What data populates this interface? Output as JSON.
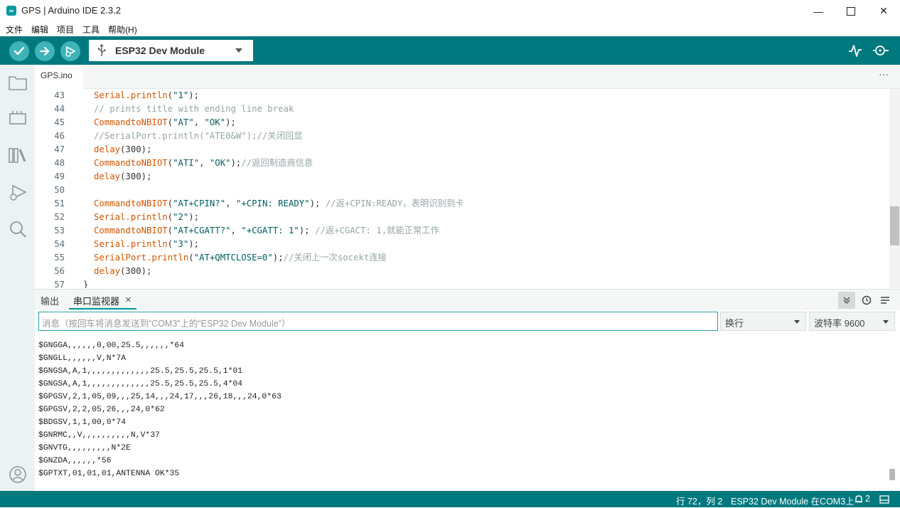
{
  "window": {
    "title": "GPS | Arduino IDE 2.3.2",
    "minimize_glyph": "—",
    "maximize_glyph": "☐",
    "close_glyph": "✕"
  },
  "menu": [
    "文件",
    "编辑",
    "项目",
    "工具",
    "帮助(H)"
  ],
  "toolbar": {
    "verify_icon": "checkmark-icon",
    "upload_icon": "arrow-right-icon",
    "debug_icon": "debug-icon",
    "board": "ESP32 Dev Module",
    "plotter_icon": "serial-plotter-icon",
    "monitor_icon": "serial-monitor-icon",
    "accent": "#00797e"
  },
  "tabs": {
    "file": "GPS.ino",
    "more": "···"
  },
  "editor": {
    "lines": [
      {
        "n": "43",
        "parts": [
          [
            "k-orange",
            "Serial.println"
          ],
          [
            "k-punc",
            "("
          ],
          [
            "k-str",
            "\"1\""
          ],
          [
            "k-punc",
            ");"
          ]
        ]
      },
      {
        "n": "44",
        "parts": [
          [
            "k-com",
            "// prints title with ending line break"
          ]
        ]
      },
      {
        "n": "45",
        "parts": [
          [
            "k-orange",
            "CommandtoNBIOT"
          ],
          [
            "k-punc",
            "("
          ],
          [
            "k-str",
            "\"AT\""
          ],
          [
            "k-punc",
            ", "
          ],
          [
            "k-str",
            "\"OK\""
          ],
          [
            "k-punc",
            ");"
          ]
        ]
      },
      {
        "n": "46",
        "parts": [
          [
            "k-com",
            "//SerialPort.println(\"ATE0&W\");//关闭回显"
          ]
        ]
      },
      {
        "n": "47",
        "parts": [
          [
            "k-orange",
            "delay"
          ],
          [
            "k-punc",
            "(300);"
          ]
        ]
      },
      {
        "n": "48",
        "parts": [
          [
            "k-orange",
            "CommandtoNBIOT"
          ],
          [
            "k-punc",
            "("
          ],
          [
            "k-str",
            "\"ATI\""
          ],
          [
            "k-punc",
            ", "
          ],
          [
            "k-str",
            "\"OK\""
          ],
          [
            "k-punc",
            ");"
          ],
          [
            "k-com",
            "//返回制造商信息"
          ]
        ]
      },
      {
        "n": "49",
        "parts": [
          [
            "k-orange",
            "delay"
          ],
          [
            "k-punc",
            "(300);"
          ]
        ]
      },
      {
        "n": "50",
        "parts": []
      },
      {
        "n": "51",
        "parts": [
          [
            "k-orange",
            "CommandtoNBIOT"
          ],
          [
            "k-punc",
            "("
          ],
          [
            "k-str",
            "\"AT+CPIN?\""
          ],
          [
            "k-punc",
            ", "
          ],
          [
            "k-str",
            "\"+CPIN: READY\""
          ],
          [
            "k-punc",
            "); "
          ],
          [
            "k-com",
            "//返+CPIN:READY，表明识别到卡"
          ]
        ]
      },
      {
        "n": "52",
        "parts": [
          [
            "k-orange",
            "Serial.println"
          ],
          [
            "k-punc",
            "("
          ],
          [
            "k-str",
            "\"2\""
          ],
          [
            "k-punc",
            ");"
          ]
        ]
      },
      {
        "n": "53",
        "parts": [
          [
            "k-orange",
            "CommandtoNBIOT"
          ],
          [
            "k-punc",
            "("
          ],
          [
            "k-str",
            "\"AT+CGATT?\""
          ],
          [
            "k-punc",
            ", "
          ],
          [
            "k-str",
            "\"+CGATT: 1\""
          ],
          [
            "k-punc",
            "); "
          ],
          [
            "k-com",
            "//返+CGACT: 1,就能正常工作"
          ]
        ]
      },
      {
        "n": "54",
        "parts": [
          [
            "k-orange",
            "Serial.println"
          ],
          [
            "k-punc",
            "("
          ],
          [
            "k-str",
            "\"3\""
          ],
          [
            "k-punc",
            ");"
          ]
        ]
      },
      {
        "n": "55",
        "parts": [
          [
            "k-orange",
            "SerialPort.println"
          ],
          [
            "k-punc",
            "("
          ],
          [
            "k-str",
            "\"AT+QMTCLOSE=0\""
          ],
          [
            "k-punc",
            ");"
          ],
          [
            "k-com",
            "//关闭上一次socekt连接"
          ]
        ]
      },
      {
        "n": "56",
        "parts": [
          [
            "k-orange",
            "delay"
          ],
          [
            "k-punc",
            "(300);"
          ]
        ]
      },
      {
        "n": "57",
        "parts": [
          [
            "k-punc",
            "}"
          ]
        ]
      }
    ]
  },
  "panel": {
    "tab_output": "输出",
    "tab_serial": "串口监视器",
    "tab_close": "×",
    "input_placeholder": "消息（按回车将消息发送到“COM3”上的“ESP32 Dev Module”）",
    "line_ending": "换行",
    "baud": "波特率 9600",
    "output": [
      "$GNGGA,,,,,,0,00,25.5,,,,,,*64",
      "$GNGLL,,,,,,V,N*7A",
      "$GNGSA,A,1,,,,,,,,,,,,,25.5,25.5,25.5,1*01",
      "$GNGSA,A,1,,,,,,,,,,,,,25.5,25.5,25.5,4*04",
      "$GPGSV,2,1,05,09,,,25,14,,,24,17,,,26,18,,,24,0*63",
      "$GPGSV,2,2,05,26,,,24,0*62",
      "$BDGSV,1,1,00,0*74",
      "$GNRMC,,V,,,,,,,,,,N,V*37",
      "$GNVTG,,,,,,,,,N*2E",
      "$GNZDA,,,,,,*56",
      "$GPTXT,01,01,01,ANTENNA OK*35"
    ]
  },
  "status": {
    "position": "行 72，列 2",
    "board_port": "ESP32 Dev Module 在COM3上",
    "notifications": "2"
  }
}
